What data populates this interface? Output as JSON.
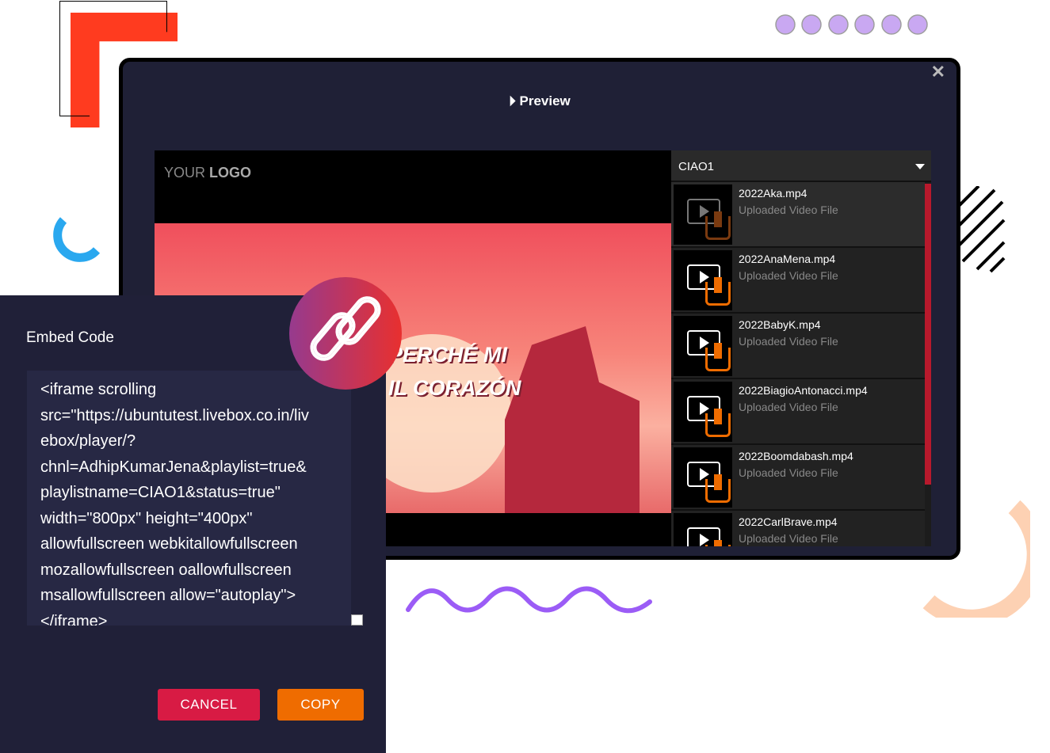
{
  "preview": {
    "close": "✕",
    "title": "Preview",
    "logo_prefix": "YOUR ",
    "logo_bold": "LOGO",
    "video_text": [
      "PERCHÉ MI",
      "IL CORAZÓN"
    ]
  },
  "playlist": {
    "selected": "CIAO1",
    "items": [
      {
        "name": "2022Aka.mp4",
        "sub": "Uploaded Video File"
      },
      {
        "name": "2022AnaMena.mp4",
        "sub": "Uploaded Video File"
      },
      {
        "name": "2022BabyK.mp4",
        "sub": "Uploaded Video File"
      },
      {
        "name": "2022BiagioAntonacci.mp4",
        "sub": "Uploaded Video File"
      },
      {
        "name": "2022Boomdabash.mp4",
        "sub": "Uploaded Video File"
      },
      {
        "name": "2022CarlBrave.mp4",
        "sub": "Uploaded Video File"
      }
    ]
  },
  "embed": {
    "title": "Embed Code",
    "lines": [
      "<iframe scrolling",
      "src=\"https://ubuntutest.livebox.co.in/liv",
      "ebox/player/?",
      "chnl=AdhipKumarJena&playlist=true&",
      "playlistname=CIAO1&status=true\"",
      "width=\"800px\" height=\"400px\"",
      "allowfullscreen webkitallowfullscreen",
      "mozallowfullscreen oallowfullscreen",
      "msallowfullscreen allow=\"autoplay\">",
      "</iframe>"
    ],
    "cancel": "CANCEL",
    "copy": "COPY"
  },
  "colors": {
    "cancel": "#d81b44",
    "copy": "#ef6c00",
    "panel": "#202038"
  }
}
